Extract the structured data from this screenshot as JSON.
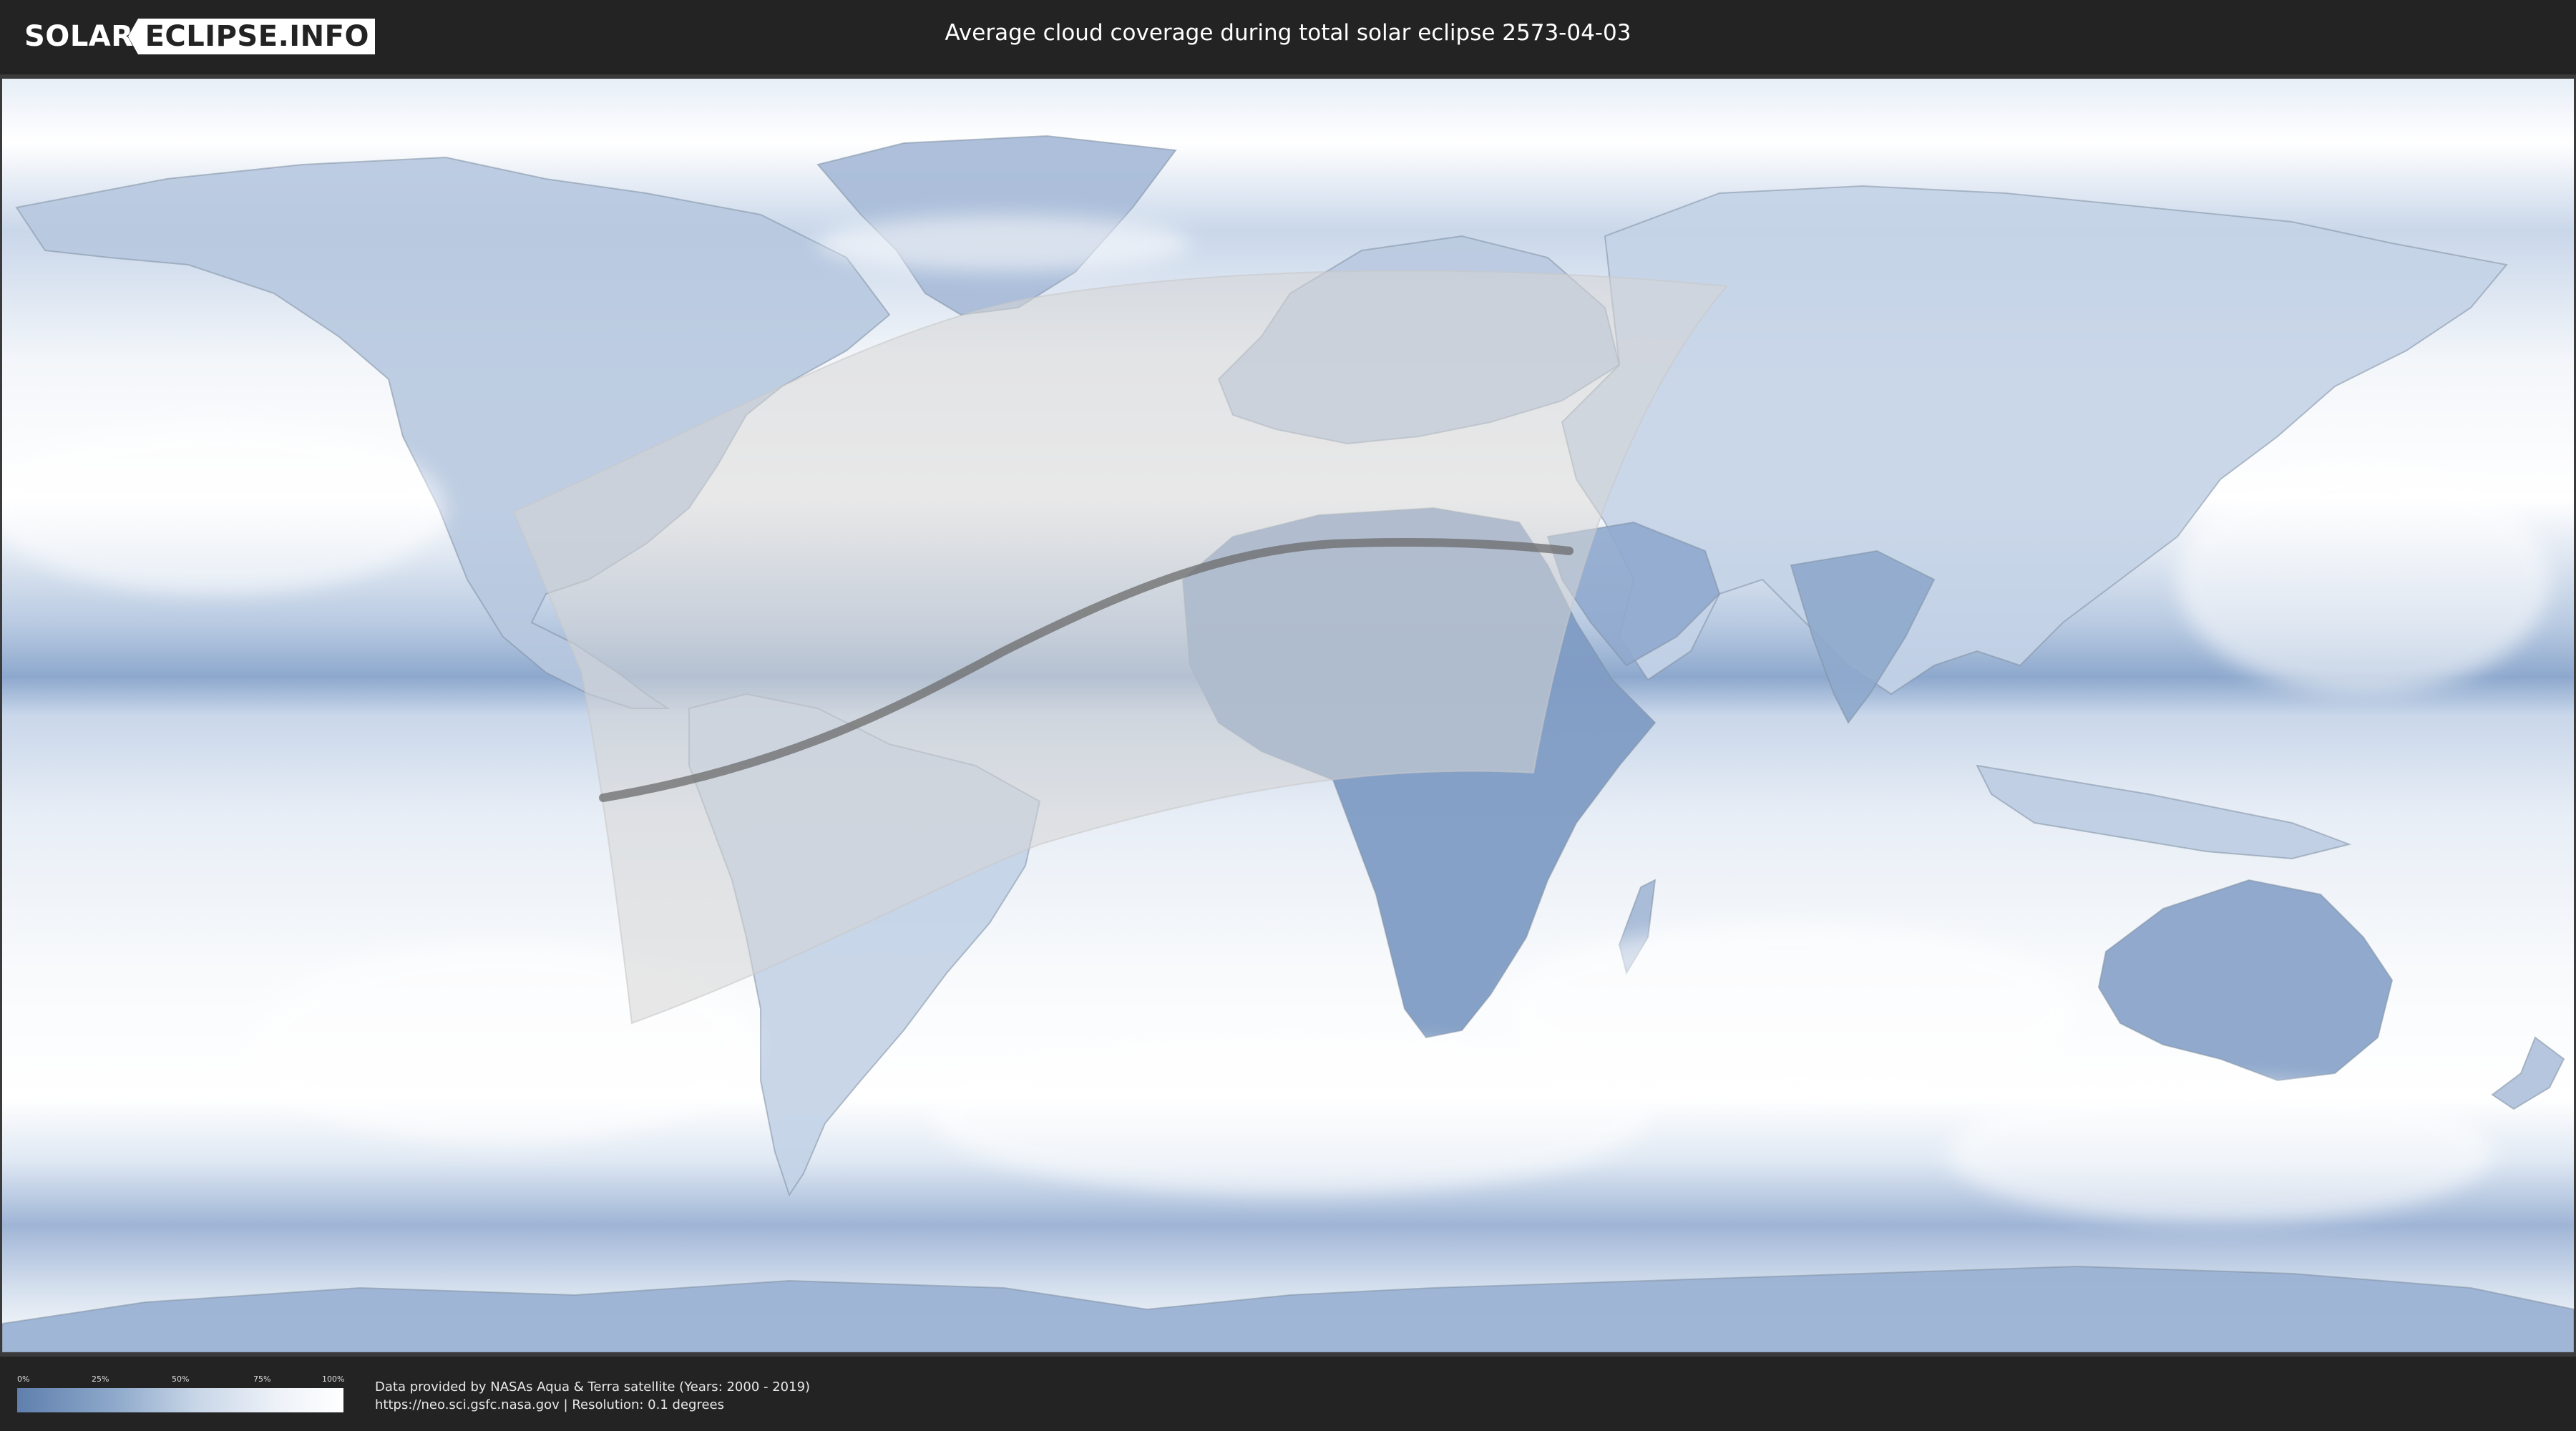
{
  "header": {
    "logo_left": "SOLAR",
    "logo_right": "ECLIPSE.INFO",
    "title": "Average cloud coverage during total solar eclipse 2573-04-03"
  },
  "legend": {
    "ticks": [
      "0%",
      "25%",
      "50%",
      "75%",
      "100%"
    ],
    "gradient_colors": [
      "#5f7fad",
      "#8ea9cb",
      "#c8d6e7",
      "#eef2f8",
      "#ffffff"
    ]
  },
  "credits": {
    "line1": "Data provided by NASAs Aqua & Terra satellite (Years: 2000 - 2019)",
    "line2": "https://neo.sci.gsfc.nasa.gov | Resolution: 0.1 degrees"
  },
  "map": {
    "projection": "equirectangular",
    "ocean_color": "#dfe8f3",
    "cloud_low_color": "#6d8ab5",
    "cloud_high_color": "#ffffff",
    "path_band_color": "#cfcfcf",
    "centerline_color": "#6b6b6b"
  }
}
